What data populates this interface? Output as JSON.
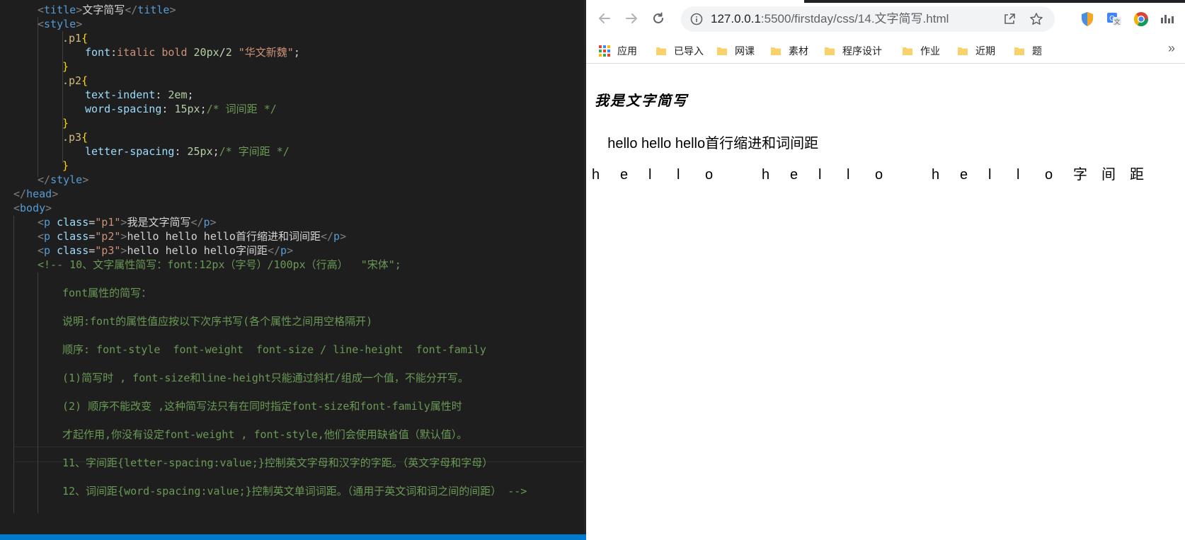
{
  "editor": {
    "lines": [
      {
        "parts": [
          {
            "t": "<",
            "c": "punc"
          },
          {
            "t": "title",
            "c": "tag"
          },
          {
            "t": ">",
            "c": "punc"
          },
          {
            "t": "文字简写",
            "c": "text"
          },
          {
            "t": "</",
            "c": "punc"
          },
          {
            "t": "title",
            "c": "tag"
          },
          {
            "t": ">",
            "c": "punc"
          }
        ]
      },
      {
        "parts": [
          {
            "t": "<",
            "c": "punc"
          },
          {
            "t": "style",
            "c": "tag"
          },
          {
            "t": ">",
            "c": "punc"
          }
        ]
      },
      {
        "parts": [
          {
            "t": ".p1",
            "c": "sel"
          },
          {
            "t": "{",
            "c": "brace"
          }
        ]
      },
      {
        "parts": [
          {
            "t": "font",
            "c": "prop"
          },
          {
            "t": ":",
            "c": "text"
          },
          {
            "t": "italic bold ",
            "c": "val"
          },
          {
            "t": "20px",
            "c": "num"
          },
          {
            "t": "/",
            "c": "text"
          },
          {
            "t": "2",
            "c": "num"
          },
          {
            "t": " \"华文新魏\"",
            "c": "str"
          },
          {
            "t": ";",
            "c": "text"
          }
        ]
      },
      {
        "parts": [
          {
            "t": "}",
            "c": "brace"
          }
        ]
      },
      {
        "parts": [
          {
            "t": ".p2",
            "c": "sel"
          },
          {
            "t": "{",
            "c": "brace"
          }
        ]
      },
      {
        "parts": [
          {
            "t": "text-indent",
            "c": "prop"
          },
          {
            "t": ": ",
            "c": "text"
          },
          {
            "t": "2em",
            "c": "num"
          },
          {
            "t": ";",
            "c": "text"
          }
        ]
      },
      {
        "parts": [
          {
            "t": "word-spacing",
            "c": "prop"
          },
          {
            "t": ": ",
            "c": "text"
          },
          {
            "t": "15px",
            "c": "num"
          },
          {
            "t": ";",
            "c": "text"
          },
          {
            "t": "/* 词间距 */",
            "c": "comment"
          }
        ]
      },
      {
        "parts": [
          {
            "t": "}",
            "c": "brace"
          }
        ]
      },
      {
        "parts": [
          {
            "t": ".p3",
            "c": "sel"
          },
          {
            "t": "{",
            "c": "brace"
          }
        ]
      },
      {
        "parts": [
          {
            "t": "letter-spacing",
            "c": "prop"
          },
          {
            "t": ": ",
            "c": "text"
          },
          {
            "t": "25px",
            "c": "num"
          },
          {
            "t": ";",
            "c": "text"
          },
          {
            "t": "/* 字间距 */",
            "c": "comment"
          }
        ]
      },
      {
        "parts": [
          {
            "t": "}",
            "c": "brace"
          }
        ]
      },
      {
        "parts": [
          {
            "t": "</",
            "c": "punc"
          },
          {
            "t": "style",
            "c": "tag"
          },
          {
            "t": ">",
            "c": "punc"
          }
        ]
      },
      {
        "parts": [
          {
            "t": "</",
            "c": "punc"
          },
          {
            "t": "head",
            "c": "tag"
          },
          {
            "t": ">",
            "c": "punc"
          }
        ]
      },
      {
        "parts": [
          {
            "t": "<",
            "c": "punc"
          },
          {
            "t": "body",
            "c": "tag"
          },
          {
            "t": ">",
            "c": "punc"
          }
        ]
      },
      {
        "parts": [
          {
            "t": "<",
            "c": "punc"
          },
          {
            "t": "p",
            "c": "tag"
          },
          {
            "t": " class",
            "c": "attr"
          },
          {
            "t": "=",
            "c": "text"
          },
          {
            "t": "\"p1\"",
            "c": "str"
          },
          {
            "t": ">",
            "c": "punc"
          },
          {
            "t": "我是文字简写",
            "c": "text"
          },
          {
            "t": "</",
            "c": "punc"
          },
          {
            "t": "p",
            "c": "tag"
          },
          {
            "t": ">",
            "c": "punc"
          }
        ]
      },
      {
        "parts": [
          {
            "t": "<",
            "c": "punc"
          },
          {
            "t": "p",
            "c": "tag"
          },
          {
            "t": " class",
            "c": "attr"
          },
          {
            "t": "=",
            "c": "text"
          },
          {
            "t": "\"p2\"",
            "c": "str"
          },
          {
            "t": ">",
            "c": "punc"
          },
          {
            "t": "hello hello hello首行缩进和词间距",
            "c": "text"
          },
          {
            "t": "</",
            "c": "punc"
          },
          {
            "t": "p",
            "c": "tag"
          },
          {
            "t": ">",
            "c": "punc"
          }
        ]
      },
      {
        "parts": [
          {
            "t": "<",
            "c": "punc"
          },
          {
            "t": "p",
            "c": "tag"
          },
          {
            "t": " class",
            "c": "attr"
          },
          {
            "t": "=",
            "c": "text"
          },
          {
            "t": "\"p3\"",
            "c": "str"
          },
          {
            "t": ">",
            "c": "punc"
          },
          {
            "t": "hello hello hello字间距",
            "c": "text"
          },
          {
            "t": "</",
            "c": "punc"
          },
          {
            "t": "p",
            "c": "tag"
          },
          {
            "t": ">",
            "c": "punc"
          }
        ]
      },
      {
        "parts": [
          {
            "t": "<!-- 10、文字属性简写：font:12px（字号）/100px（行高）  \"宋体\";",
            "c": "comment"
          }
        ]
      },
      {
        "parts": []
      },
      {
        "parts": [
          {
            "t": "font属性的简写：",
            "c": "comment"
          }
        ]
      },
      {
        "parts": []
      },
      {
        "parts": [
          {
            "t": "说明:font的属性值应按以下次序书写(各个属性之间用空格隔开)",
            "c": "comment"
          }
        ]
      },
      {
        "parts": []
      },
      {
        "parts": [
          {
            "t": "顺序: font-style  font-weight  font-size / line-height  font-family",
            "c": "comment"
          }
        ]
      },
      {
        "parts": []
      },
      {
        "parts": [
          {
            "t": "(1)简写时 , font-size和line-height只能通过斜杠/组成一个值，不能分开写。",
            "c": "comment"
          }
        ]
      },
      {
        "parts": []
      },
      {
        "parts": [
          {
            "t": "(2) 顺序不能改变 ,这种简写法只有在同时指定font-size和font-family属性时",
            "c": "comment"
          }
        ]
      },
      {
        "parts": []
      },
      {
        "parts": [
          {
            "t": "才起作用,你没有设定font-weight , font-style,他们会使用缺省值（默认值）。",
            "c": "comment"
          }
        ]
      },
      {
        "parts": []
      },
      {
        "parts": [
          {
            "t": "11、字间距{letter-spacing:value;}控制英文字母和汉字的字距。（英文字母和字母）",
            "c": "comment"
          }
        ]
      },
      {
        "parts": []
      },
      {
        "parts": [
          {
            "t": "12、词间距{word-spacing:value;}控制英文单词词距。（通用于英文词和词之间的间距） -->",
            "c": "comment"
          }
        ]
      }
    ]
  },
  "browser": {
    "url_host": "127.0.0.1",
    "url_path": ":5500/firstday/css/14.文字简写.html",
    "back_icon": "arrow-left-icon",
    "forward_icon": "arrow-right-icon",
    "reload_icon": "reload-icon",
    "bookmarks": [
      {
        "label": "应用",
        "icon": "apps-grid-icon"
      },
      {
        "label": "已导入",
        "icon": "folder-icon"
      },
      {
        "label": "网课",
        "icon": "folder-icon"
      },
      {
        "label": "素材",
        "icon": "folder-icon"
      },
      {
        "label": "程序设计",
        "icon": "folder-icon"
      },
      {
        "label": "作业",
        "icon": "folder-icon"
      },
      {
        "label": "近期",
        "icon": "folder-icon"
      },
      {
        "label": "题",
        "icon": "folder-icon"
      }
    ],
    "bookmarks_more": "»",
    "page": {
      "p1": "我是文字简写",
      "p2": "hello hello hello首行缩进和词间距",
      "p3_chars": [
        "h",
        "e",
        "l",
        "l",
        "o",
        " ",
        "h",
        "e",
        "l",
        "l",
        "o",
        " ",
        "h",
        "e",
        "l",
        "l",
        "o",
        "字",
        "间",
        "距"
      ]
    }
  },
  "colors": {
    "editor_bg": "#1e1e1e",
    "comment": "#6a9955",
    "tag": "#569cd6",
    "string": "#ce9178",
    "status_bar": "#007acc",
    "folder": "#f9d26b"
  }
}
